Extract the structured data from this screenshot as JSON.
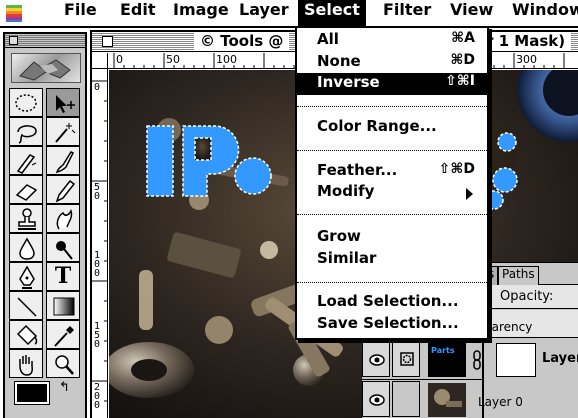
{
  "menubar": {
    "items": [
      {
        "label": "File"
      },
      {
        "label": "Edit"
      },
      {
        "label": "Image"
      },
      {
        "label": "Layer"
      },
      {
        "label": "Select"
      },
      {
        "label": "Filter"
      },
      {
        "label": "View"
      },
      {
        "label": "Window"
      }
    ],
    "active": "Select"
  },
  "document": {
    "title": "© Tools @",
    "title_tail": "r 1 Mask)",
    "ruler_h": [
      "0",
      "50",
      "100",
      "300"
    ],
    "ruler_v": [
      [
        "0"
      ],
      [
        "5",
        "0"
      ],
      [
        "1",
        "0",
        "0"
      ],
      [
        "1",
        "5",
        "0"
      ],
      [
        "2",
        "0",
        "0"
      ]
    ],
    "selection_color": "#3399ff",
    "selection_text": "Pa"
  },
  "select_menu": {
    "items": [
      {
        "label": "All",
        "shortcut": "⌘A"
      },
      {
        "label": "None",
        "shortcut": "⌘D"
      },
      {
        "label": "Inverse",
        "shortcut": "⇧⌘I"
      },
      {
        "label": "Color Range..."
      },
      {
        "label": "Feather...",
        "shortcut": "⇧⌘D"
      },
      {
        "label": "Modify"
      },
      {
        "label": "Grow"
      },
      {
        "label": "Similar"
      },
      {
        "label": "Load Selection..."
      },
      {
        "label": "Save Selection..."
      }
    ],
    "highlighted": "Inverse"
  },
  "layers_palette": {
    "tabs": [
      {
        "label": "s"
      },
      {
        "label": "Paths"
      }
    ],
    "opacity_label": "Opacity:",
    "transparency_label": "parency",
    "layers": [
      {
        "thumb_label": "Parts",
        "name": "Layer"
      },
      {
        "name": "Layer 0"
      }
    ]
  },
  "toolbox": {
    "tools": [
      {
        "icon": "marquee-icon"
      },
      {
        "icon": "move-icon"
      },
      {
        "icon": "lasso-icon"
      },
      {
        "icon": "magic-wand-icon"
      },
      {
        "icon": "airbrush-icon"
      },
      {
        "icon": "paintbrush-icon"
      },
      {
        "icon": "eraser-icon"
      },
      {
        "icon": "pencil-icon"
      },
      {
        "icon": "rubber-stamp-icon"
      },
      {
        "icon": "smudge-icon"
      },
      {
        "icon": "blur-icon"
      },
      {
        "icon": "dodge-icon"
      },
      {
        "icon": "pen-icon"
      },
      {
        "icon": "type-icon",
        "label": "T"
      },
      {
        "icon": "line-icon"
      },
      {
        "icon": "gradient-icon"
      },
      {
        "icon": "paint-bucket-icon"
      },
      {
        "icon": "eyedropper-icon"
      },
      {
        "icon": "hand-icon"
      },
      {
        "icon": "zoom-icon"
      }
    ]
  }
}
